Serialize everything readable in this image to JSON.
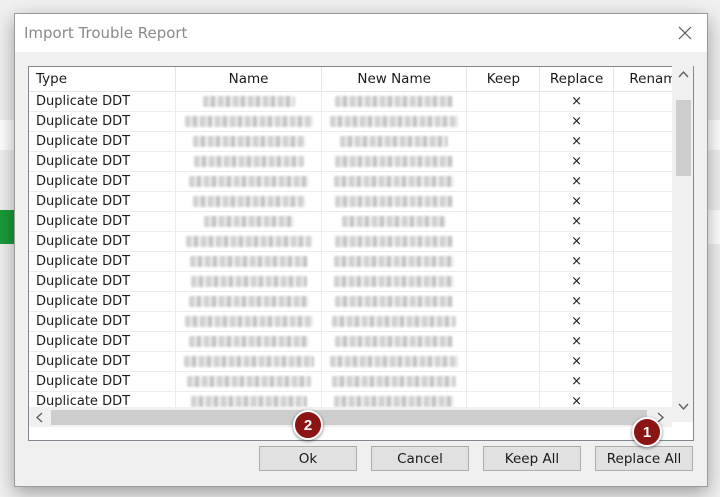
{
  "dialog": {
    "title": "Import Trouble Report",
    "close_icon": "close-icon"
  },
  "table": {
    "columns": [
      "Type",
      "Name",
      "New Name",
      "Keep",
      "Replace",
      "Renam"
    ],
    "rows": [
      {
        "type": "Duplicate DDT",
        "replace": "×"
      },
      {
        "type": "Duplicate DDT",
        "replace": "×"
      },
      {
        "type": "Duplicate DDT",
        "replace": "×"
      },
      {
        "type": "Duplicate DDT",
        "replace": "×"
      },
      {
        "type": "Duplicate DDT",
        "replace": "×"
      },
      {
        "type": "Duplicate DDT",
        "replace": "×"
      },
      {
        "type": "Duplicate DDT",
        "replace": "×"
      },
      {
        "type": "Duplicate DDT",
        "replace": "×"
      },
      {
        "type": "Duplicate DDT",
        "replace": "×"
      },
      {
        "type": "Duplicate DDT",
        "replace": "×"
      },
      {
        "type": "Duplicate DDT",
        "replace": "×"
      },
      {
        "type": "Duplicate DDT",
        "replace": "×"
      },
      {
        "type": "Duplicate DDT",
        "replace": "×"
      },
      {
        "type": "Duplicate DDT",
        "replace": "×"
      },
      {
        "type": "Duplicate DDT",
        "replace": "×"
      },
      {
        "type": "Duplicate DDT",
        "replace": "×"
      }
    ]
  },
  "buttons": {
    "ok": "Ok",
    "cancel": "Cancel",
    "keep_all": "Keep All",
    "replace_all": "Replace All"
  },
  "annotations": {
    "badge_1": "1",
    "badge_2": "2",
    "badge_color": "#8b1515"
  }
}
